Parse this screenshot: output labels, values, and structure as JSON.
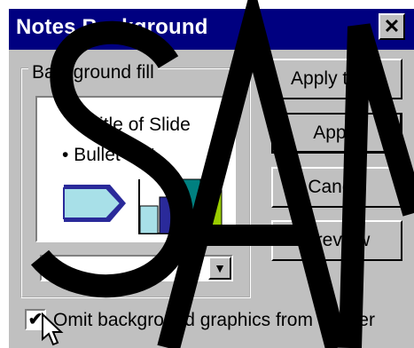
{
  "dialog": {
    "title": "Notes Background",
    "close_glyph": "✕"
  },
  "background_fill": {
    "group_label": "Background fill",
    "preview": {
      "slide_title": "Title of Slide",
      "bullet_text": "• Bullet text"
    },
    "color_combo": {
      "value": "",
      "arrow_glyph": "▼"
    }
  },
  "buttons": {
    "apply_to_all": "Apply to All",
    "apply": "Apply",
    "cancel": "Cancel",
    "preview": "Preview"
  },
  "omit_checkbox": {
    "label": "Omit background graphics from master",
    "checked": true,
    "check_glyph": "✔"
  },
  "watermark": {
    "text": "SAM"
  },
  "colors": {
    "titlebar": "#000080",
    "dialog": "#c0c0c0",
    "arrow_fill": "#a8e0e8",
    "bar_1": "#a8e0e8",
    "bar_2": "#2a2a9a",
    "bar_3": "#008080",
    "bar_4": "#99cc00"
  },
  "icons": [
    "close-icon",
    "chevron-down-icon",
    "arrow-cursor-icon",
    "checkmark-icon"
  ]
}
